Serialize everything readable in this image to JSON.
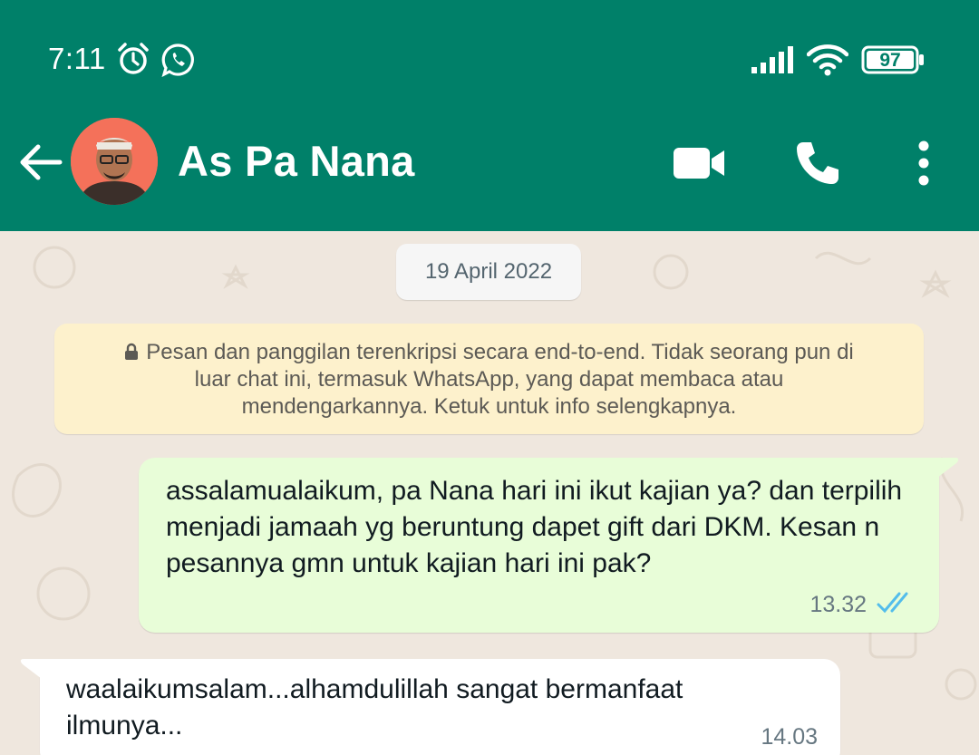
{
  "status_bar": {
    "time": "7:11",
    "battery": "97",
    "icons": [
      "alarm-icon",
      "whatsapp-icon",
      "signal-icon",
      "wifi-icon",
      "battery-icon"
    ]
  },
  "header": {
    "contact_name": "As Pa Nana",
    "icons": [
      "back-arrow-icon",
      "video-call-icon",
      "voice-call-icon",
      "more-options-icon"
    ],
    "color": "#008069"
  },
  "chat": {
    "date_chip": "19 April 2022",
    "encryption_notice": "Pesan dan panggilan terenkripsi secara end-to-end. Tidak seorang pun di luar chat ini, termasuk WhatsApp, yang dapat membaca atau mendengarkannya. Ketuk untuk info selengkapnya.",
    "messages": [
      {
        "direction": "outgoing",
        "text": "assalamualaikum, pa Nana hari ini ikut kajian ya? dan terpilih menjadi jamaah yg beruntung dapet gift dari DKM. Kesan n pesannya gmn untuk kajian hari ini pak?",
        "time": "13.32",
        "status": "read"
      },
      {
        "direction": "incoming",
        "text": "waalaikumsalam...alhamdulillah sangat bermanfaat ilmunya...",
        "time": "14.03"
      }
    ],
    "colors": {
      "outgoing_bubble": "#e8fdd8",
      "incoming_bubble": "#ffffff",
      "notice_bg": "#fdf1cc",
      "read_ticks": "#53bdeb"
    }
  }
}
